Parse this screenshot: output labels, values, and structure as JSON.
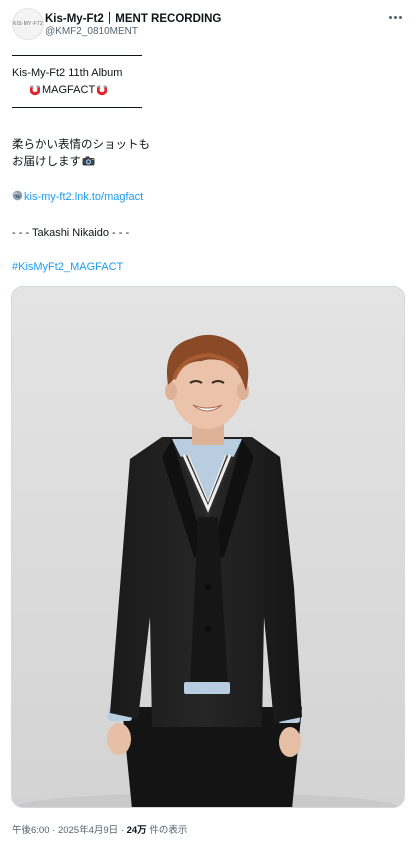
{
  "account": {
    "avatar_text": "KIS·MY·FT2",
    "display_name": "Kis-My-Ft2｜MENT RECORDING",
    "handle": "@KMF2_0810MENT"
  },
  "tweet": {
    "album_line": "Kis-My-Ft2 11th Album",
    "album_name": "MAGFACT",
    "message_line1": "柔らかい表情のショットも",
    "message_line2": "お届けします",
    "link": "kis-my-ft2.lnk.to/magfact",
    "credit": "- - - Takashi Nikaido - - -",
    "hashtag": "#KisMyFt2_MAGFACT"
  },
  "meta": {
    "time": "午後6:00",
    "separator": "·",
    "date": "2025年4月9日",
    "views_count": "24万",
    "views_label": "件の表示"
  },
  "icons": [
    "magnet-icon",
    "camera-icon",
    "globe-icon",
    "more-icon"
  ],
  "colors": {
    "link": "#1d9bf0",
    "secondary_text": "#536471",
    "magnet_red": "#e0242c"
  }
}
